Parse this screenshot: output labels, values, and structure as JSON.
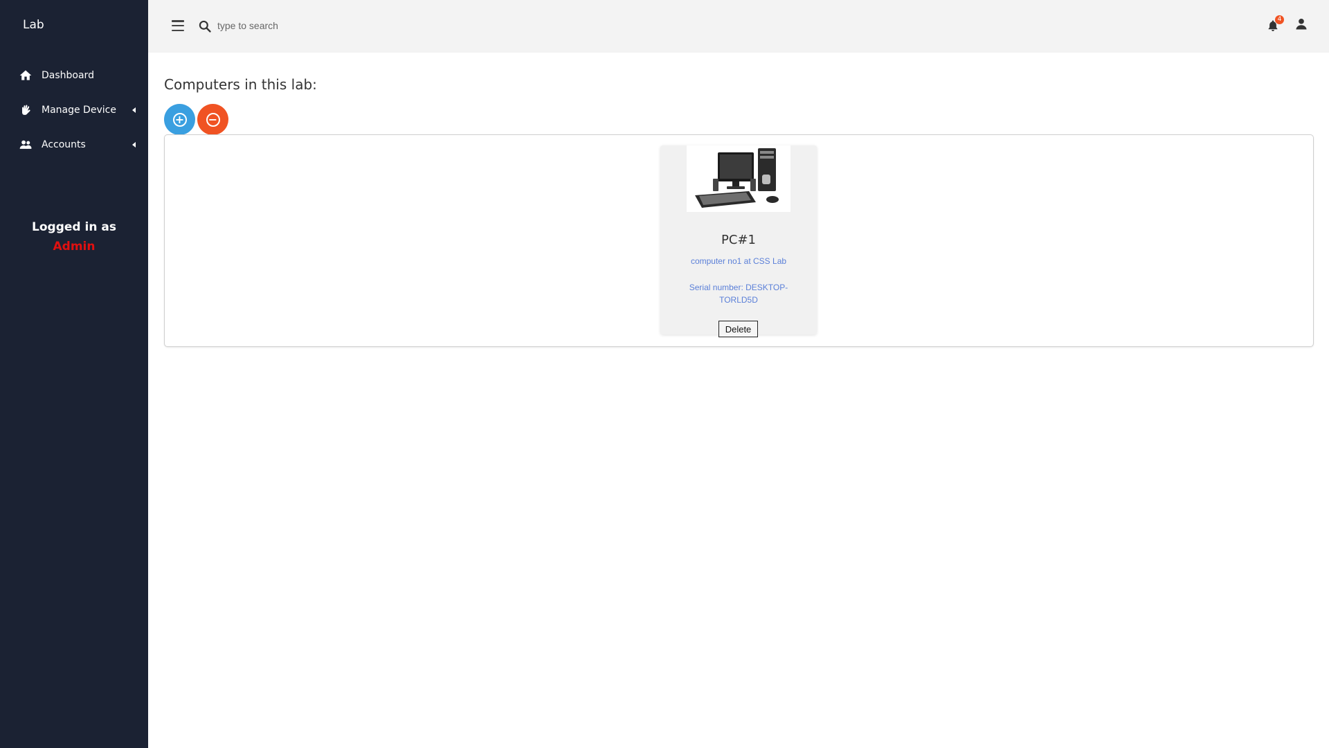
{
  "sidebar": {
    "brand": "Lab",
    "items": [
      {
        "label": "Dashboard",
        "icon": "home-icon",
        "has_submenu": false
      },
      {
        "label": "Manage Device",
        "icon": "hand-icon",
        "has_submenu": true
      },
      {
        "label": "Accounts",
        "icon": "users-icon",
        "has_submenu": true
      }
    ],
    "logged_in": {
      "label": "Logged in as",
      "user": "Admin"
    }
  },
  "topbar": {
    "search_placeholder": "type to search",
    "notifications_count": "4"
  },
  "main": {
    "title": "Computers in this lab:",
    "add_button_symbol": "+",
    "remove_button_symbol": "−",
    "computers": [
      {
        "name": "PC#1",
        "description": "computer no1 at CSS Lab",
        "serial": "Serial number: DESKTOP-TORLD5D",
        "delete_label": "Delete"
      }
    ]
  },
  "colors": {
    "sidebar_bg": "#1b2233",
    "topbar_bg": "#f3f3f3",
    "add_button": "#3a9fe0",
    "remove_button": "#f05323",
    "admin_text": "#e01010",
    "link_text": "#5a7fd8",
    "badge": "#f05323"
  }
}
